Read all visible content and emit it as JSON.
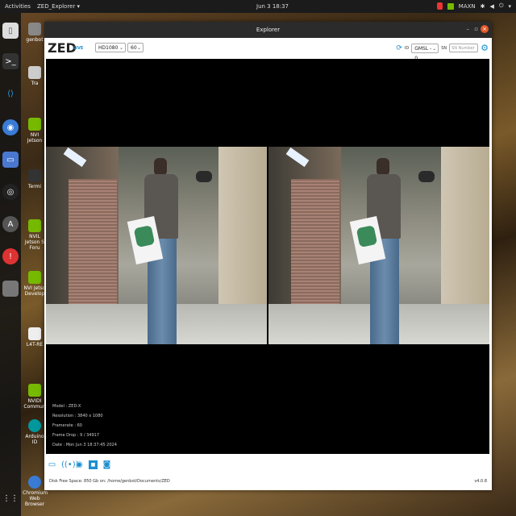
{
  "topbar": {
    "activities": "Activities",
    "app_menu": "ZED_Explorer ▾",
    "clock": "Jun 3  18:37",
    "user": "MAXN"
  },
  "desktop_icons": [
    {
      "label": "genbot"
    },
    {
      "label": "Tra"
    },
    {
      "label": "NVI Jetson"
    },
    {
      "label": "Termi"
    },
    {
      "label": "NVIL Jetson S Foru"
    },
    {
      "label": "NVI Jetso Develop"
    },
    {
      "label": "L4T-RE"
    },
    {
      "label": "NVIDI Commun"
    },
    {
      "label": "Arduino ID"
    },
    {
      "label": "Chromium Web Browser"
    }
  ],
  "window": {
    "title": "Explorer",
    "controls": {
      "minimize": "–",
      "maximize": "▫",
      "close": "×"
    }
  },
  "toolbar": {
    "logo": "ZED",
    "live_badge": "LIVE",
    "resolution": "HD1080",
    "fps": "60",
    "id_label": "ID",
    "camera_select": "GMSL - 0",
    "sn_label": "SN",
    "sn_placeholder": "SN Number"
  },
  "camera_info": {
    "model": "Model : ZED-X",
    "resolution": "Resolution : 3840 x 1080",
    "framerate": "Framerate : 60",
    "frame_drop": "Frame Drop : 9 / 34917",
    "date": "Date : Mon Jun 3 18:37:45 2024"
  },
  "bottom_icons": [
    "folder-icon",
    "broadcast-icon",
    "sensor-icon",
    "video-icon",
    "snapshot-icon"
  ],
  "status": {
    "disk": "Disk Free Space: 850 Gb  on: /home/genbot/Documents/ZED",
    "version": "v4.0.8"
  },
  "colors": {
    "accent": "#1c8fcf",
    "close": "#e05a2b"
  }
}
